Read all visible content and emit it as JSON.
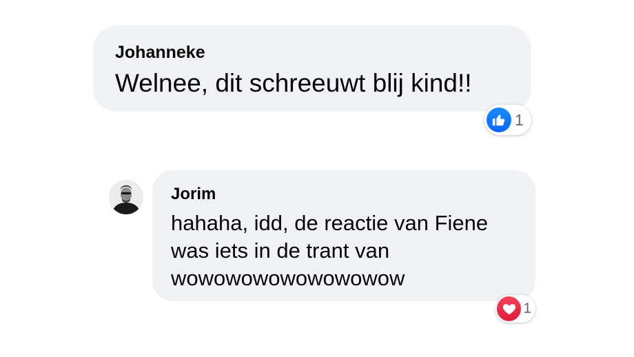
{
  "comments": [
    {
      "author": "Johanneke",
      "text": "Welnee, dit schreeuwt blij kind!!",
      "reaction": {
        "icon": "like-icon",
        "count": "1",
        "color": "#1877f2"
      }
    },
    {
      "author": "Jorim",
      "text": "hahaha, idd, de reactie van Fiene was iets in de trant van wowowowowowowowow",
      "avatar_icon": "avatar-icon",
      "reaction": {
        "icon": "love-icon",
        "count": "1",
        "color": "#f33e58"
      }
    }
  ],
  "colors": {
    "bubble_background": "#f0f2f5",
    "text": "#050505",
    "count_text": "#65676b"
  }
}
